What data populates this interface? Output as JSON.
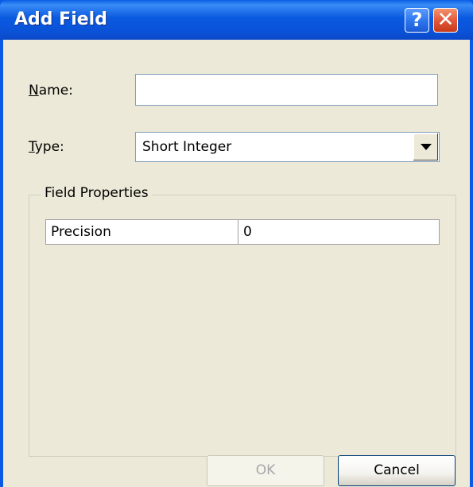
{
  "window": {
    "title": "Add Field",
    "help_glyph": "?",
    "close_glyph": "✕"
  },
  "form": {
    "name_label_mnemonic": "N",
    "name_label_rest": "ame:",
    "name_value": "",
    "type_label_mnemonic": "T",
    "type_label_rest": "ype:",
    "type_value": "Short Integer"
  },
  "field_properties": {
    "title": "Field Properties",
    "rows": [
      {
        "name": "Precision",
        "value": "0"
      }
    ]
  },
  "buttons": {
    "ok_label": "OK",
    "cancel_label": "Cancel"
  },
  "colors": {
    "titlebar": "#0a5ae3",
    "dialog_bg": "#ece9d8",
    "close_button": "#e4593a"
  },
  "icons": {
    "help": "help-icon",
    "close": "close-icon",
    "dropdown": "chevron-down-icon"
  }
}
